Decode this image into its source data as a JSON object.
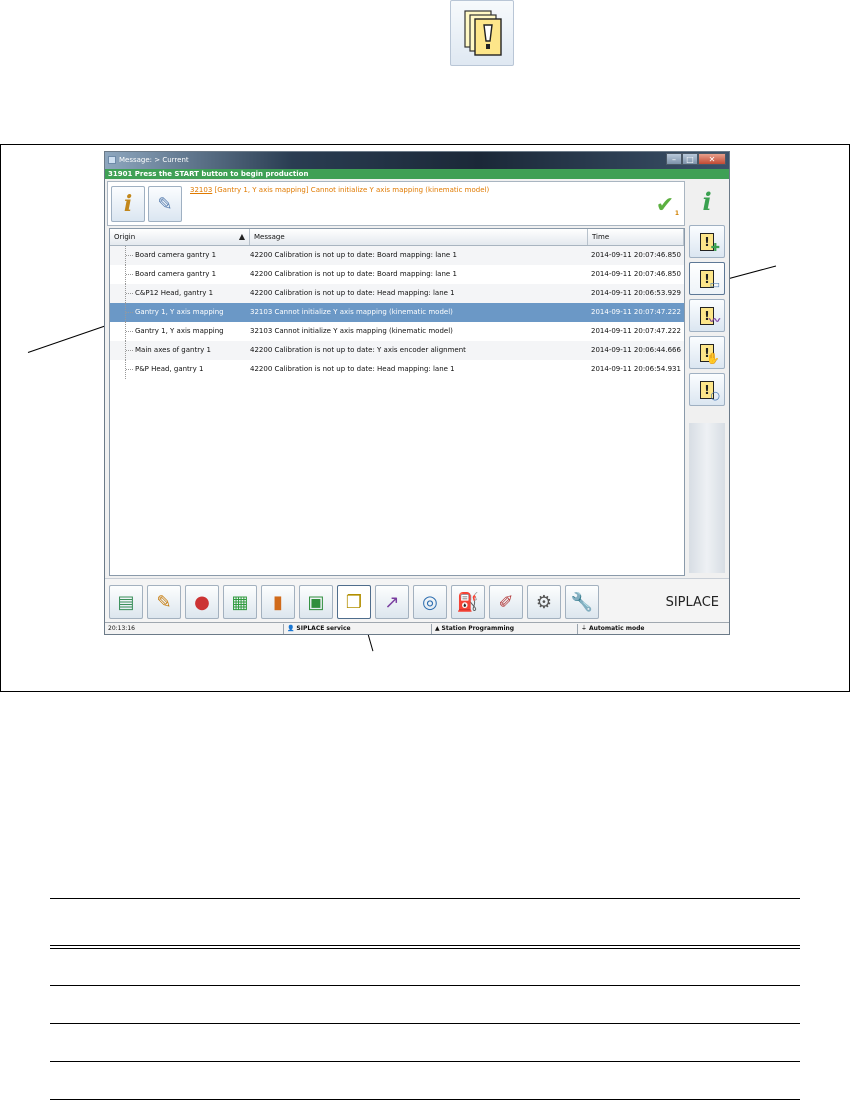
{
  "window": {
    "title": "Message: > Current",
    "status_line": "31901 Press the START button to begin production",
    "current_message": {
      "code": "32103",
      "text": " [Gantry 1, Y axis mapping] Cannot initialize Y axis mapping (kinematic model)"
    },
    "ack_count": "1"
  },
  "table": {
    "columns": [
      "Origin",
      "Message",
      "Time"
    ],
    "sort_indicator": "▲",
    "rows": [
      {
        "origin": "Board camera gantry 1",
        "message": "42200 Calibration is not up to date: Board mapping: lane 1",
        "time": "2014-09-11 20:07:46.850"
      },
      {
        "origin": "Board camera gantry 1",
        "message": "42200 Calibration is not up to date: Board mapping: lane 1",
        "time": "2014-09-11 20:07:46.850"
      },
      {
        "origin": "C&P12 Head, gantry 1",
        "message": "42200 Calibration is not up to date: Head mapping: lane 1",
        "time": "2014-09-11 20:06:53.929"
      },
      {
        "origin": "Gantry 1, Y axis mapping",
        "message": "32103 Cannot initialize Y axis mapping (kinematic model)",
        "time": "2014-09-11 20:07:47.222"
      },
      {
        "origin": "Gantry 1, Y axis mapping",
        "message": "32103 Cannot initialize Y axis mapping (kinematic model)",
        "time": "2014-09-11 20:07:47.222"
      },
      {
        "origin": "Main axes of gantry 1",
        "message": "42200 Calibration is not up to date: Y axis encoder alignment",
        "time": "2014-09-11 20:06:44.666"
      },
      {
        "origin": "P&P Head, gantry 1",
        "message": "42200 Calibration is not up to date: Head mapping: lane 1",
        "time": "2014-09-11 20:06:54.931"
      }
    ],
    "selected_row": 3
  },
  "toolbar": {
    "brand": "SIPLACE",
    "icons": [
      "stack-icon",
      "traffic-light-edit-icon",
      "traffic-light-stop-icon",
      "grid-green-icon",
      "bar-chart-icon",
      "board-icon",
      "messages-icon",
      "trend-chart-icon",
      "camera-lens-icon",
      "oil-can-icon",
      "pen-tool-icon",
      "gear-hand-icon",
      "wrench-icon"
    ]
  },
  "statusbar": {
    "time": "20:13:16",
    "user": "SIPLACE service",
    "station": "Station Programming",
    "mode": "Automatic mode"
  },
  "colors": {
    "status_green": "#3fa055",
    "selection_blue": "#6b98c6",
    "message_orange": "#e07a00"
  }
}
